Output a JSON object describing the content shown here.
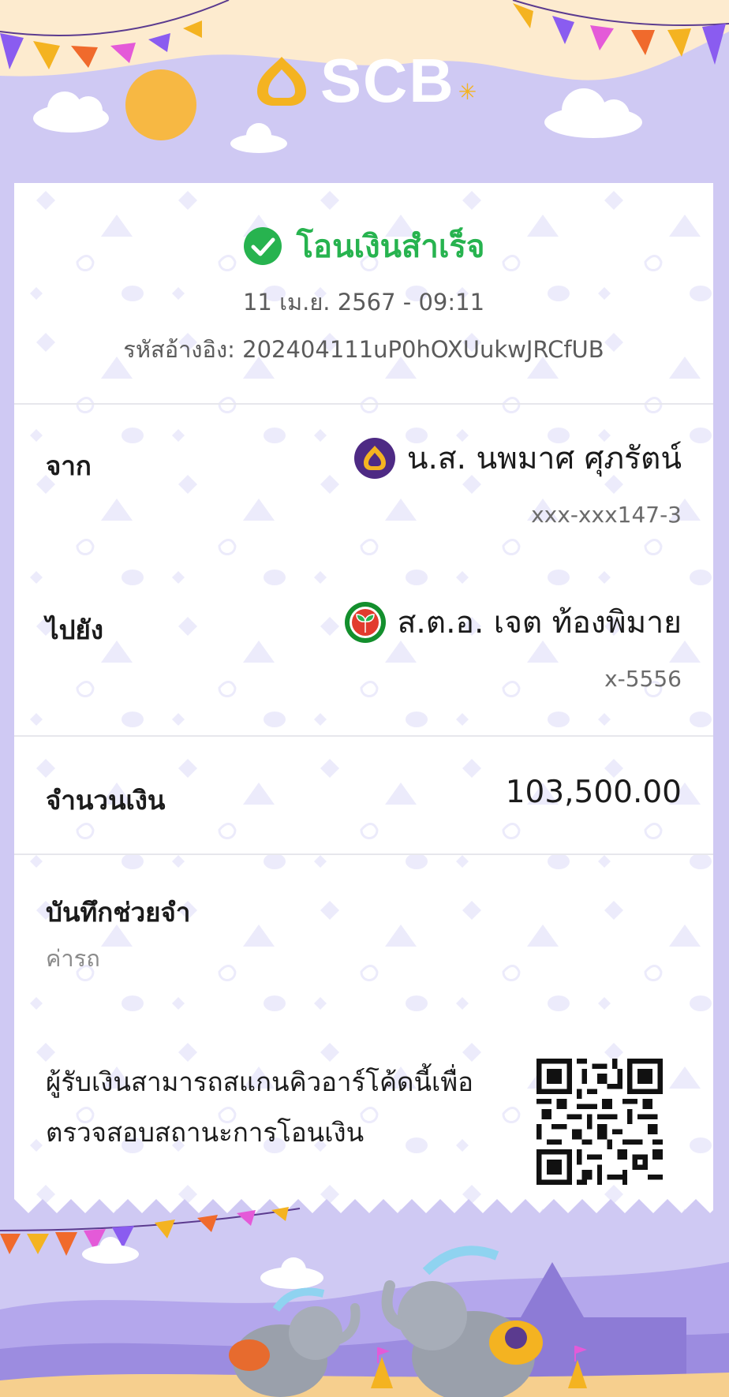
{
  "brand": {
    "name": "SCB",
    "logo_icon": "scb-logo-icon"
  },
  "receipt": {
    "status": "โอนเงินสำเร็จ",
    "status_icon": "check-circle-icon",
    "datetime": "11 เม.ย. 2567 - 09:11",
    "reference_label": "รหัสอ้างอิง:",
    "reference": "202404111uP0hOXUukwJRCfUB",
    "from": {
      "label": "จาก",
      "name": "น.ส. นพมาศ ศุภรัตน์",
      "account": "xxx-xxx147-3",
      "bank_icon": "scb-bank-icon"
    },
    "to": {
      "label": "ไปยัง",
      "name": "ส.ต.อ. เจต ท้องพิมาย",
      "account": "x-5556",
      "bank_icon": "kbank-bank-icon"
    },
    "amount_label": "จำนวนเงิน",
    "amount": "103,500.00",
    "memo_label": "บันทึกช่วยจำ",
    "memo": "ค่ารถ",
    "qr_note_line1": "ผู้รับเงินสามารถสแกนคิวอาร์โค้ดนี้เพื่อ",
    "qr_note_line2": "ตรวจสอบสถานะการโอนเงิน"
  },
  "colors": {
    "background": "#cfc9f3",
    "success": "#27b34f",
    "scb_purple": "#4e2a84",
    "scb_gold": "#f4b321",
    "kbank_green": "#138f2d"
  }
}
